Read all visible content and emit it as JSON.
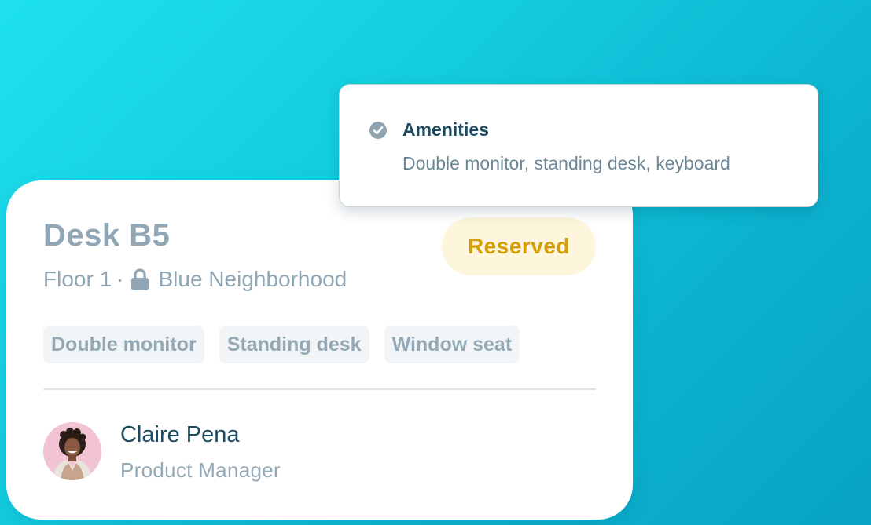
{
  "desk": {
    "title": "Desk B5",
    "floor": "Floor 1",
    "separator": "·",
    "neighborhood": "Blue Neighborhood",
    "status": "Reserved",
    "tags": [
      "Double monitor",
      "Standing desk",
      "Window seat"
    ]
  },
  "assignee": {
    "name": "Claire Pena",
    "role": "Product Manager"
  },
  "amenities": {
    "title": "Amenities",
    "description": "Double monitor, standing desk, keyboard"
  },
  "icons": {
    "lock": "lock-icon",
    "check": "check-circle-icon",
    "avatar": "avatar-photo"
  },
  "colors": {
    "background_start": "#1ee1ee",
    "background_end": "#08a3c4",
    "status_bg": "#fdf6dd",
    "status_text": "#d69e06",
    "title_text": "#1c4a60",
    "muted_text": "#90a6b4"
  }
}
